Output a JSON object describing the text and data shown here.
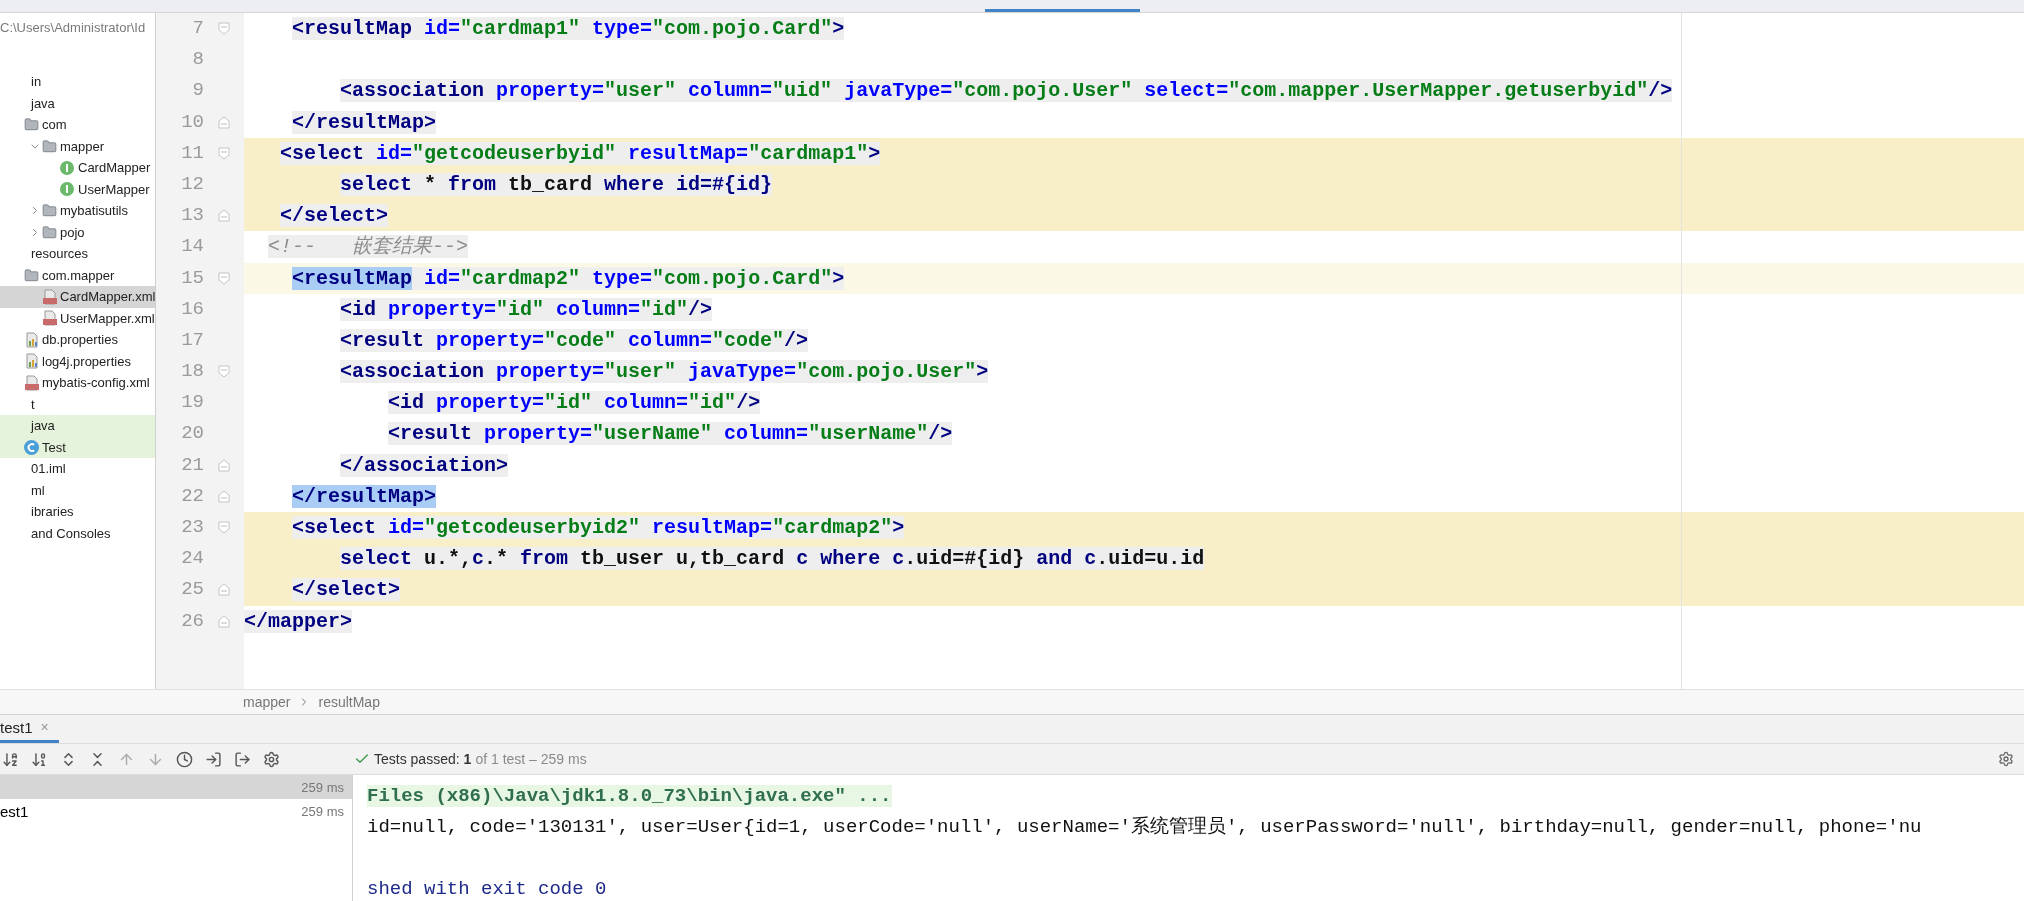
{
  "project": {
    "path": "C:\\Users\\Administrator\\Id",
    "tree": [
      {
        "label": "in",
        "selected": false,
        "tinted": false
      },
      {
        "label": "java",
        "selected": false,
        "tinted": false,
        "children": [
          {
            "label": "com",
            "kind": "package",
            "selected": false,
            "tinted": false,
            "children": [
              {
                "label": "mapper",
                "kind": "package",
                "expanded": true,
                "selected": false,
                "tinted": false,
                "children": [
                  {
                    "label": "CardMapper",
                    "kind": "interface",
                    "selected": false,
                    "tinted": false
                  },
                  {
                    "label": "UserMapper",
                    "kind": "interface",
                    "selected": false,
                    "tinted": false
                  }
                ]
              },
              {
                "label": "mybatisutils",
                "kind": "package",
                "expanded": false,
                "selected": false,
                "tinted": false
              },
              {
                "label": "pojo",
                "kind": "package",
                "expanded": false,
                "selected": false,
                "tinted": false
              }
            ]
          }
        ]
      },
      {
        "label": "resources",
        "selected": false,
        "tinted": false,
        "children": [
          {
            "label": "com.mapper",
            "kind": "folder",
            "selected": false,
            "tinted": false,
            "children": [
              {
                "label": "CardMapper.xml",
                "kind": "xml",
                "selected": true,
                "tinted": false
              },
              {
                "label": "UserMapper.xml",
                "kind": "xml",
                "selected": false,
                "tinted": false
              }
            ]
          },
          {
            "label": "db.properties",
            "kind": "properties",
            "selected": false,
            "tinted": false
          },
          {
            "label": "log4j.properties",
            "kind": "properties",
            "selected": false,
            "tinted": false
          },
          {
            "label": "mybatis-config.xml",
            "kind": "xml",
            "selected": false,
            "tinted": false
          }
        ]
      },
      {
        "label": "t",
        "selected": false,
        "tinted": false
      },
      {
        "label": "java",
        "selected": false,
        "tinted": true,
        "children": [
          {
            "label": "Test",
            "kind": "class",
            "selected": false,
            "tinted": true
          }
        ]
      },
      {
        "label": "01.iml",
        "selected": false,
        "tinted": false
      },
      {
        "label": "ml",
        "selected": false,
        "tinted": false
      },
      {
        "label": "ibraries",
        "selected": false,
        "tinted": false
      },
      {
        "label": "and Consoles",
        "selected": false,
        "tinted": false
      }
    ]
  },
  "editor": {
    "lines": [
      {
        "number": "7",
        "fold_open": true,
        "fold_close": false,
        "highlighted": false,
        "current": false,
        "tokens": [
          {
            "kind": "tag",
            "text": "    <resultMap "
          },
          {
            "kind": "attr",
            "text": "id="
          },
          {
            "kind": "value",
            "text": "\"cardmap1\" "
          },
          {
            "kind": "attr",
            "text": "type="
          },
          {
            "kind": "value",
            "text": "\"com.pojo.Card\""
          },
          {
            "kind": "tag",
            "text": ">"
          }
        ]
      },
      {
        "number": "8",
        "fold_open": false,
        "fold_close": false,
        "highlighted": false,
        "current": false
      },
      {
        "number": "9",
        "fold_open": false,
        "fold_close": false,
        "highlighted": false,
        "current": false,
        "tokens": [
          {
            "kind": "tag",
            "text": "        <association "
          },
          {
            "kind": "attr",
            "text": "property="
          },
          {
            "kind": "value",
            "text": "\"user\" "
          },
          {
            "kind": "attr",
            "text": "column="
          },
          {
            "kind": "value",
            "text": "\"uid\" "
          },
          {
            "kind": "attr",
            "text": "javaType="
          },
          {
            "kind": "value",
            "text": "\"com.pojo.User\" "
          },
          {
            "kind": "attr",
            "text": "select="
          },
          {
            "kind": "value",
            "text": "\"com.mapper.UserMapper.getuserbyid\""
          },
          {
            "kind": "tag",
            "text": "/>"
          }
        ]
      },
      {
        "number": "10",
        "fold_open": false,
        "fold_close": true,
        "highlighted": false,
        "current": false,
        "tokens": [
          {
            "kind": "tag",
            "text": "    </resultMap>"
          }
        ]
      },
      {
        "number": "11",
        "fold_open": true,
        "fold_close": false,
        "highlighted": true,
        "current": false,
        "tokens": [
          {
            "kind": "tag",
            "text": "   <select "
          },
          {
            "kind": "attr",
            "text": "id="
          },
          {
            "kind": "value",
            "text": "\"getcodeuserbyid\" "
          },
          {
            "kind": "attr",
            "text": "resultMap="
          },
          {
            "kind": "value",
            "text": "\"cardmap1\""
          },
          {
            "kind": "tag",
            "text": ">"
          }
        ]
      },
      {
        "number": "12",
        "fold_open": false,
        "fold_close": false,
        "highlighted": true,
        "current": false,
        "tokens": [
          {
            "kind": "kw",
            "text": "        select"
          },
          {
            "kind": "text",
            "text": " * "
          },
          {
            "kind": "kw",
            "text": "from"
          },
          {
            "kind": "text",
            "text": " tb_card "
          },
          {
            "kind": "kw",
            "text": "where id=#{id}"
          }
        ]
      },
      {
        "number": "13",
        "fold_open": false,
        "fold_close": true,
        "highlighted": true,
        "current": false,
        "tokens": [
          {
            "kind": "tag",
            "text": "   </select>"
          }
        ]
      },
      {
        "number": "14",
        "fold_open": false,
        "fold_close": false,
        "highlighted": false,
        "current": false,
        "tokens": [
          {
            "kind": "comment",
            "text": "  <!--   嵌套结果-->"
          }
        ]
      },
      {
        "number": "15",
        "fold_open": true,
        "fold_close": false,
        "highlighted": false,
        "current": true,
        "tokens": [
          {
            "kind": "tag",
            "text": "    <resultMap",
            "matched": true
          },
          {
            "kind": "attr",
            "text": " id="
          },
          {
            "kind": "value",
            "text": "\"cardmap2\" "
          },
          {
            "kind": "attr",
            "text": "type="
          },
          {
            "kind": "value",
            "text": "\"com.pojo.Card\""
          },
          {
            "kind": "tag",
            "text": ">"
          }
        ]
      },
      {
        "number": "16",
        "fold_open": false,
        "fold_close": false,
        "highlighted": false,
        "current": false,
        "tokens": [
          {
            "kind": "tag",
            "text": "        <id "
          },
          {
            "kind": "attr",
            "text": "property="
          },
          {
            "kind": "value",
            "text": "\"id\" "
          },
          {
            "kind": "attr",
            "text": "column="
          },
          {
            "kind": "value",
            "text": "\"id\""
          },
          {
            "kind": "tag",
            "text": "/>"
          }
        ]
      },
      {
        "number": "17",
        "fold_open": false,
        "fold_close": false,
        "highlighted": false,
        "current": false,
        "tokens": [
          {
            "kind": "tag",
            "text": "        <result "
          },
          {
            "kind": "attr",
            "text": "property="
          },
          {
            "kind": "value",
            "text": "\"code\" "
          },
          {
            "kind": "attr",
            "text": "column="
          },
          {
            "kind": "value",
            "text": "\"code\""
          },
          {
            "kind": "tag",
            "text": "/>"
          }
        ]
      },
      {
        "number": "18",
        "fold_open": true,
        "fold_close": false,
        "highlighted": false,
        "current": false,
        "tokens": [
          {
            "kind": "tag",
            "text": "        <association "
          },
          {
            "kind": "attr",
            "text": "property="
          },
          {
            "kind": "value",
            "text": "\"user\" "
          },
          {
            "kind": "attr",
            "text": "javaType="
          },
          {
            "kind": "value",
            "text": "\"com.pojo.User\""
          },
          {
            "kind": "tag",
            "text": ">"
          }
        ]
      },
      {
        "number": "19",
        "fold_open": false,
        "fold_close": false,
        "highlighted": false,
        "current": false,
        "tokens": [
          {
            "kind": "tag",
            "text": "            <id "
          },
          {
            "kind": "attr",
            "text": "property="
          },
          {
            "kind": "value",
            "text": "\"id\" "
          },
          {
            "kind": "attr",
            "text": "column="
          },
          {
            "kind": "value",
            "text": "\"id\""
          },
          {
            "kind": "tag",
            "text": "/>"
          }
        ]
      },
      {
        "number": "20",
        "fold_open": false,
        "fold_close": false,
        "highlighted": false,
        "current": false,
        "tokens": [
          {
            "kind": "tag",
            "text": "            <result "
          },
          {
            "kind": "attr",
            "text": "property="
          },
          {
            "kind": "value",
            "text": "\"userName\" "
          },
          {
            "kind": "attr",
            "text": "column="
          },
          {
            "kind": "value",
            "text": "\"userName\""
          },
          {
            "kind": "tag",
            "text": "/>"
          }
        ]
      },
      {
        "number": "21",
        "fold_open": false,
        "fold_close": true,
        "highlighted": false,
        "current": false,
        "tokens": [
          {
            "kind": "tag",
            "text": "        </association>"
          }
        ]
      },
      {
        "number": "22",
        "fold_open": false,
        "fold_close": true,
        "highlighted": false,
        "current": false,
        "tokens": [
          {
            "kind": "tag",
            "text": "    </resultMap>",
            "matched": true
          }
        ]
      },
      {
        "number": "23",
        "fold_open": true,
        "fold_close": false,
        "highlighted": true,
        "current": false,
        "tokens": [
          {
            "kind": "tag",
            "text": "    <select "
          },
          {
            "kind": "attr",
            "text": "id="
          },
          {
            "kind": "value",
            "text": "\"getcodeuserbyid2\" "
          },
          {
            "kind": "attr",
            "text": "resultMap="
          },
          {
            "kind": "value",
            "text": "\"cardmap2\""
          },
          {
            "kind": "tag",
            "text": ">"
          }
        ]
      },
      {
        "number": "24",
        "fold_open": false,
        "fold_close": false,
        "highlighted": true,
        "current": false,
        "tokens": [
          {
            "kind": "kw",
            "text": "        select"
          },
          {
            "kind": "text",
            "text": " u.*,"
          },
          {
            "kind": "kw",
            "text": "c"
          },
          {
            "kind": "text",
            "text": ".* "
          },
          {
            "kind": "kw",
            "text": "from"
          },
          {
            "kind": "text",
            "text": " tb_user u,tb_card "
          },
          {
            "kind": "kw",
            "text": "c where c"
          },
          {
            "kind": "text",
            "text": ".uid=#{id} "
          },
          {
            "kind": "kw",
            "text": "and c"
          },
          {
            "kind": "text",
            "text": ".uid=u.id"
          }
        ]
      },
      {
        "number": "25",
        "fold_open": false,
        "fold_close": true,
        "highlighted": true,
        "current": false,
        "tokens": [
          {
            "kind": "tag",
            "text": "    </select>"
          }
        ]
      },
      {
        "number": "26",
        "fold_open": false,
        "fold_close": true,
        "highlighted": false,
        "current": false,
        "tokens": [
          {
            "kind": "tag",
            "text": "</mapper>"
          }
        ]
      }
    ],
    "breadcrumb": [
      "mapper",
      "resultMap"
    ]
  },
  "run": {
    "tab": {
      "label": "test1",
      "close": "×"
    },
    "status": {
      "label": "Tests passed:",
      "count": "1",
      "detail": "of 1 test – 259 ms"
    },
    "tests": [
      {
        "time": "259 ms",
        "selected": true
      },
      {
        "label": "est1",
        "time": "259 ms",
        "selected": false
      }
    ],
    "console": [
      {
        "kind": "command",
        "text": "Files (x86)\\Java\\jdk1.8.0_73\\bin\\java.exe\" ..."
      },
      {
        "kind": "output",
        "text": "id=null, code='130131', user=User{id=1, userCode='null', userName='系统管理员', userPassword='null', birthday=null, gender=null, phone='nu"
      },
      {
        "kind": "blank"
      },
      {
        "kind": "exit",
        "text": "shed with exit code 0"
      }
    ]
  }
}
